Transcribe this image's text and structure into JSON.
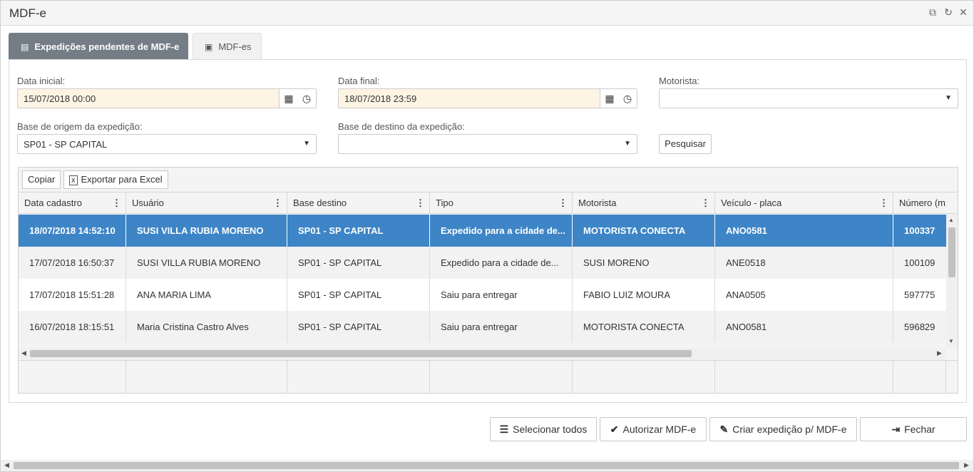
{
  "window": {
    "title": "MDF-e"
  },
  "tabs": [
    {
      "label": "Expedições pendentes de MDF-e",
      "icon": "document-icon",
      "active": true
    },
    {
      "label": "MDF-es",
      "icon": "money-icon",
      "active": false
    }
  ],
  "filters": {
    "data_inicial": {
      "label": "Data inicial:",
      "value": "15/07/2018 00:00"
    },
    "data_final": {
      "label": "Data final:",
      "value": "18/07/2018 23:59"
    },
    "motorista": {
      "label": "Motorista:",
      "value": ""
    },
    "base_origem": {
      "label": "Base de origem da expedição:",
      "value": "SP01 - SP CAPITAL"
    },
    "base_destino": {
      "label": "Base de destino da expedição:",
      "value": ""
    },
    "pesquisar_label": "Pesquisar"
  },
  "grid_toolbar": {
    "copiar": "Copiar",
    "exportar": "Exportar para Excel"
  },
  "grid": {
    "columns": [
      "Data cadastro",
      "Usuário",
      "Base destino",
      "Tipo",
      "Motorista",
      "Veículo - placa",
      "Número (m"
    ],
    "rows": [
      [
        "18/07/2018 14:52:10",
        "SUSI VILLA RUBIA MORENO",
        "SP01 - SP CAPITAL",
        "Expedido para a cidade de...",
        "MOTORISTA CONECTA",
        "ANO0581",
        "100337"
      ],
      [
        "17/07/2018 16:50:37",
        "SUSI VILLA RUBIA MORENO",
        "SP01 - SP CAPITAL",
        "Expedido para a cidade de...",
        "SUSI MORENO",
        "ANE0518",
        "100109"
      ],
      [
        "17/07/2018 15:51:28",
        "ANA MARIA LIMA",
        "SP01 - SP CAPITAL",
        "Saiu para entregar",
        "FABIO LUIZ MOURA",
        "ANA0505",
        "597775"
      ],
      [
        "16/07/2018 18:15:51",
        "Maria Cristina Castro Alves",
        "SP01 - SP CAPITAL",
        "Saiu para entregar",
        "MOTORISTA CONECTA",
        "ANO0581",
        "596829"
      ]
    ],
    "selected_row": 0
  },
  "actions": {
    "selecionar_todos": "Selecionar todos",
    "autorizar": "Autorizar MDF-e",
    "criar_expedicao": "Criar expedição p/ MDF-e",
    "fechar": "Fechar"
  },
  "colors": {
    "tab_active": "#747d86",
    "row_selected": "#3d85c6",
    "date_field_bg": "#fdf4e4"
  }
}
